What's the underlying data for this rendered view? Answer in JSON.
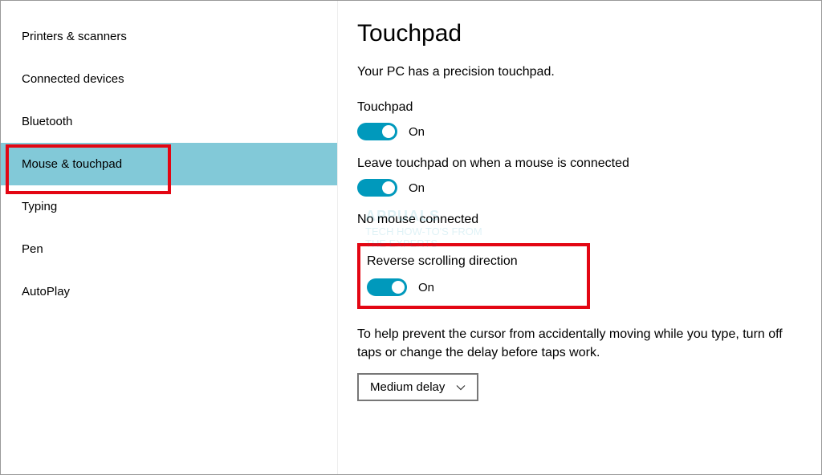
{
  "sidebar": {
    "items": [
      {
        "label": "Printers & scanners"
      },
      {
        "label": "Connected devices"
      },
      {
        "label": "Bluetooth"
      },
      {
        "label": "Mouse & touchpad"
      },
      {
        "label": "Typing"
      },
      {
        "label": "Pen"
      },
      {
        "label": "AutoPlay"
      }
    ]
  },
  "page": {
    "title": "Touchpad",
    "description": "Your PC has a precision touchpad."
  },
  "settings": {
    "touchpad": {
      "label": "Touchpad",
      "state": "On"
    },
    "leave_on": {
      "label": "Leave touchpad on when a mouse is connected",
      "state": "On"
    },
    "mouse_status": "No mouse connected",
    "reverse": {
      "label": "Reverse scrolling direction",
      "state": "On"
    },
    "help_text": "To help prevent the cursor from accidentally moving while you type, turn off taps or change the delay before taps work.",
    "delay": {
      "selected": "Medium delay"
    }
  },
  "watermark": {
    "title": "APPUALS",
    "line1": "TECH HOW-TO'S FROM",
    "line2": "THE EXPERTS"
  }
}
